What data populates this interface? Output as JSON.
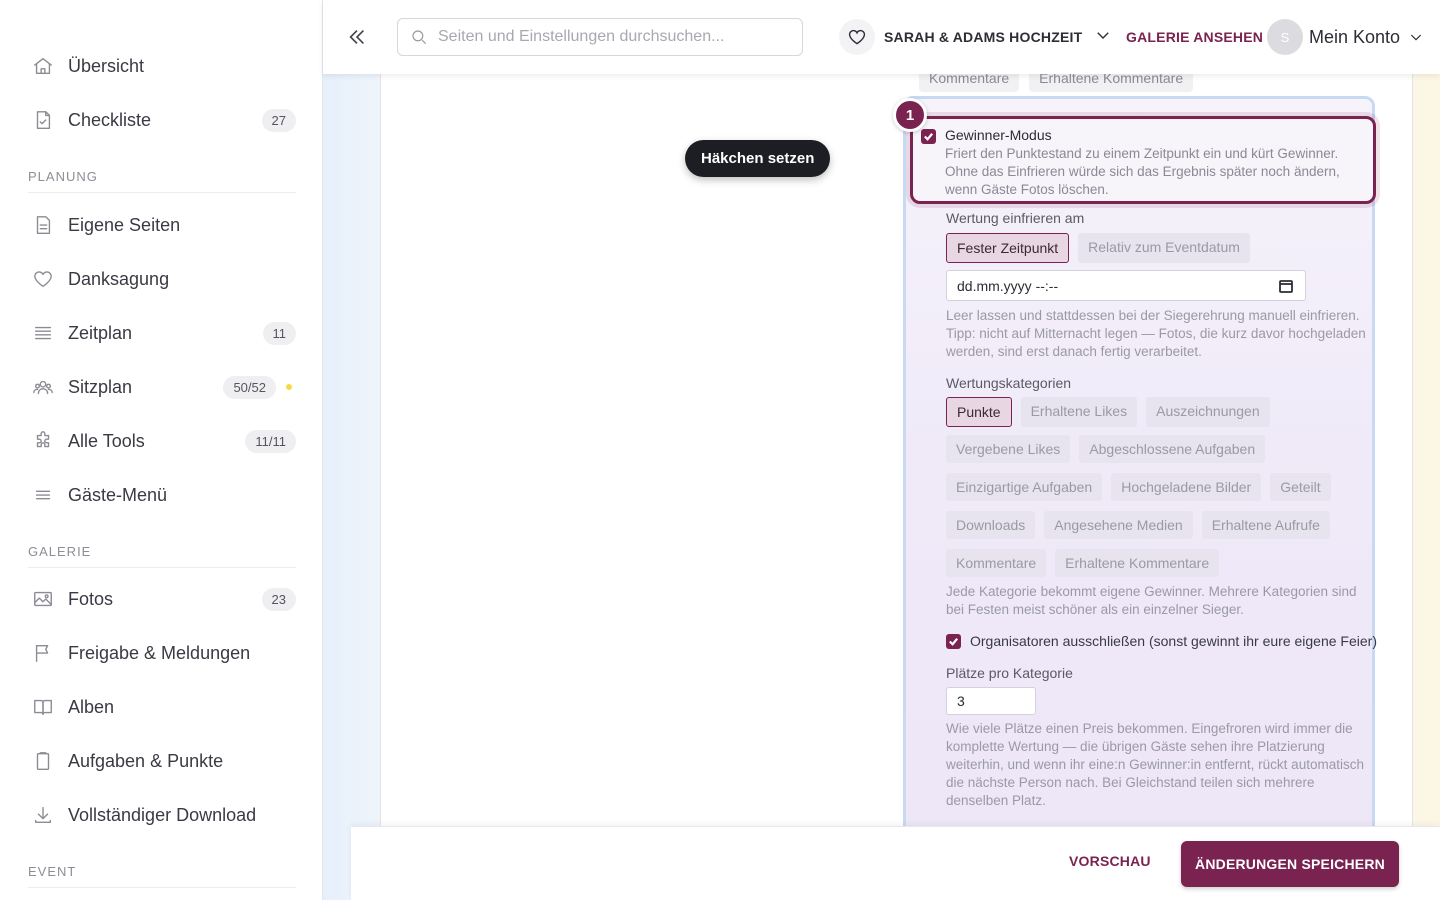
{
  "sidebar": {
    "items": [
      {
        "label": "Übersicht",
        "icon": "home-icon"
      },
      {
        "label": "Checkliste",
        "icon": "checklist-icon",
        "badge": "27"
      }
    ],
    "sections": [
      {
        "title": "PLANUNG",
        "items": [
          {
            "label": "Eigene Seiten",
            "icon": "page-icon"
          },
          {
            "label": "Danksagung",
            "icon": "heart-icon"
          },
          {
            "label": "Zeitplan",
            "icon": "schedule-icon",
            "badge": "11"
          },
          {
            "label": "Sitzplan",
            "icon": "people-icon",
            "badge": "50/52"
          },
          {
            "label": "Alle Tools",
            "icon": "puzzle-icon",
            "badge": "11/11"
          },
          {
            "label": "Gäste-Menü",
            "icon": "menu-icon"
          }
        ]
      },
      {
        "title": "GALERIE",
        "items": [
          {
            "label": "Fotos",
            "icon": "image-icon",
            "badge": "23"
          },
          {
            "label": "Freigabe & Meldungen",
            "icon": "flag-icon"
          },
          {
            "label": "Alben",
            "icon": "book-icon"
          },
          {
            "label": "Aufgaben & Punkte",
            "icon": "clipboard-icon"
          },
          {
            "label": "Vollständiger Download",
            "icon": "download-icon"
          }
        ]
      },
      {
        "title": "EVENT",
        "items": []
      }
    ],
    "status_dot_color": "#f6d84a"
  },
  "topbar": {
    "search_placeholder": "Seiten und Einstellungen durchsuchen...",
    "event_name": "SARAH & ADAMS HOCHZEIT",
    "gallery_link": "GALERIE ANSEHEN",
    "avatar_initial": "S",
    "account_label": "Mein Konto"
  },
  "tooltip": "Häkchen setzen",
  "step_number": "1",
  "top_tabs": [
    "Kommentare",
    "Erhaltene Kommentare"
  ],
  "winner_mode": {
    "title": "Gewinner-Modus",
    "description": "Friert den Punktestand zu einem Zeitpunkt ein und kürt Gewinner. Ohne das Einfrieren würde sich das Ergebnis später noch ändern, wenn Gäste Fotos löschen.",
    "checked": true
  },
  "freeze": {
    "label": "Wertung einfrieren am",
    "options": [
      "Fester Zeitpunkt",
      "Relativ zum Eventdatum"
    ],
    "selected": "Fester Zeitpunkt",
    "date_value": "dd.mm.yyyy --:--",
    "help": "Leer lassen und stattdessen bei der Siegerehrung manuell einfrieren. Tipp: nicht auf Mitternacht legen — Fotos, die kurz davor hochgeladen werden, sind erst danach fertig verarbeitet."
  },
  "categories": {
    "label": "Wertungskategorien",
    "rows": [
      [
        "Punkte",
        "Erhaltene Likes",
        "Auszeichnungen"
      ],
      [
        "Vergebene Likes",
        "Abgeschlossene Aufgaben"
      ],
      [
        "Einzigartige Aufgaben",
        "Hochgeladene Bilder",
        "Geteilt"
      ],
      [
        "Downloads",
        "Angesehene Medien",
        "Erhaltene Aufrufe"
      ],
      [
        "Kommentare",
        "Erhaltene Kommentare"
      ]
    ],
    "selected": "Punkte",
    "help": "Jede Kategorie bekommt eigene Gewinner. Mehrere Kategorien sind bei Festen meist schöner als ein einzelner Sieger."
  },
  "exclude_organizers": {
    "label": "Organisatoren ausschließen (sonst gewinnt ihr eure eigene Feier)",
    "checked": true
  },
  "places": {
    "label": "Plätze pro Kategorie",
    "value": "3",
    "help": "Wie viele Plätze einen Preis bekommen. Eingefroren wird immer die komplette Wertung — die übrigen Gäste sehen ihre Platzierung weiterhin, und wenn ihr eine:n Gewinner:in entfernt, rückt automatisch die nächste Person nach. Bei Gleichstand teilen sich mehrere denselben Platz."
  },
  "footer": {
    "preview": "VORSCHAU",
    "save": "ÄNDERUNGEN SPEICHERN"
  },
  "colors": {
    "accent": "#7b2350",
    "panel_border": "#c8d9f3"
  }
}
